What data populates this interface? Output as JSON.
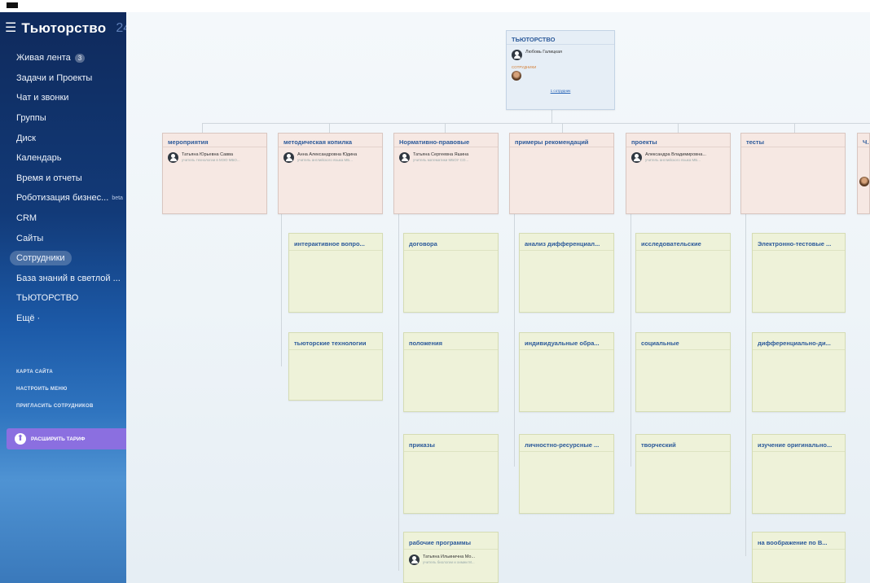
{
  "app": {
    "menu_icon": "☰",
    "logo": "Тьюторство",
    "logo_suffix": "24"
  },
  "sidebar": {
    "items": [
      {
        "label": "Живая лента",
        "badge": "3"
      },
      {
        "label": "Задачи и Проекты"
      },
      {
        "label": "Чат и звонки"
      },
      {
        "label": "Группы"
      },
      {
        "label": "Диск"
      },
      {
        "label": "Календарь"
      },
      {
        "label": "Время и отчеты"
      },
      {
        "label": "Роботизация бизнес...",
        "tag": "beta"
      },
      {
        "label": "CRM"
      },
      {
        "label": "Сайты"
      },
      {
        "label": "Сотрудники",
        "active": true
      },
      {
        "label": "База знаний в светлой ..."
      },
      {
        "label": "ТЬЮТОРСТВО"
      },
      {
        "label": "Ещё ·"
      }
    ],
    "small_links": [
      "Карта сайта",
      "Настроить меню",
      "Пригласить сотрудников"
    ],
    "upgrade_label": "Расширить тариф",
    "colors": {
      "accent": "#8b6fe0",
      "sidebar_top": "#0f2a5c"
    }
  },
  "structure": {
    "root": {
      "title": "ТЬЮТОРСТВО",
      "head_name": "Любовь Галицкая",
      "employees_label": "Сотрудники",
      "employees_link": "1 сотрудник"
    },
    "departments": [
      {
        "title": "мероприятия",
        "person": "Татьяна Юрьевна Савва",
        "desc": "учитель технологии в МЭО МБО..."
      },
      {
        "title": "методическая копилка",
        "person": "Анна Александровна Юдина",
        "desc": "учитель английского языка МБ..."
      },
      {
        "title": "Нормативно-правовые",
        "person": "Татьяна Сергеевна Яшина",
        "desc": "учитель математики МБОУ СО..."
      },
      {
        "title": "примеры рекомендаций"
      },
      {
        "title": "проекты",
        "person": "Александра Владимировна...",
        "desc": "учитель английского языка МБ..."
      },
      {
        "title": "тесты"
      },
      {
        "title": "Ча"
      }
    ],
    "sub": {
      "col2": [
        "интерактивное вопро...",
        "тьюторские технологии"
      ],
      "col3": [
        "договора",
        "положения",
        "приказы",
        "рабочие программы"
      ],
      "col4": [
        "анализ дифференциал...",
        "индивидуальные обра...",
        "личностно-ресурсные ..."
      ],
      "col5": [
        "исследовательские",
        "социальные",
        "творческий"
      ],
      "col6": [
        "Электронно-тестовые ...",
        "дифференциально-ди...",
        "изучение оригинально...",
        "на воображение по В..."
      ]
    },
    "rp_person": {
      "name": "Татьяна Ильинична Мо...",
      "desc": "учитель биологии и химии М..."
    }
  }
}
